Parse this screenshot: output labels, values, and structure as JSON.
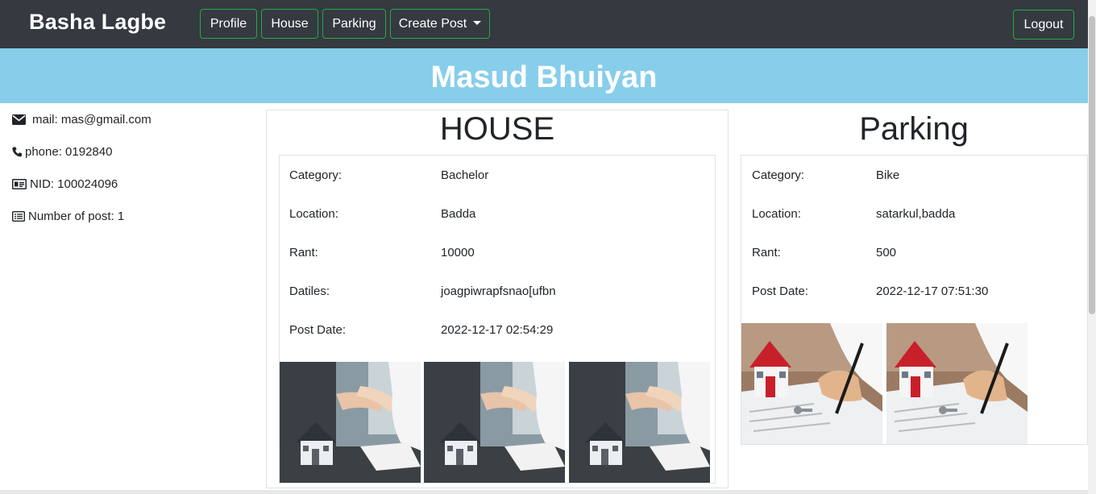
{
  "navbar": {
    "brand": "Basha Lagbe",
    "profile_label": "Profile",
    "house_label": "House",
    "parking_label": "Parking",
    "create_post_label": "Create Post",
    "logout_label": "Logout",
    "accent_color": "#28a745",
    "background": "#343a40"
  },
  "banner": {
    "name": "Masud Bhuiyan",
    "background": "#87ceeb"
  },
  "user_info": {
    "mail": "mail: mas@gmail.com",
    "phone": "phone: 0192840",
    "nid": "NID: 100024096",
    "posts": "Number of post: 1"
  },
  "house": {
    "title": "HOUSE",
    "fields": [
      {
        "label": "Category:",
        "value": "Bachelor"
      },
      {
        "label": "Location:",
        "value": "Badda"
      },
      {
        "label": "Rant:",
        "value": "10000"
      },
      {
        "label": "Datiles:",
        "value": "joagpiwrapfsnao[ufbn"
      },
      {
        "label": "Post Date:",
        "value": "2022-12-17 02:54:29"
      }
    ],
    "photo_icon": "handshake-house-photo"
  },
  "parking": {
    "title": "Parking",
    "fields": [
      {
        "label": "Category:",
        "value": "Bike"
      },
      {
        "label": "Location:",
        "value": "satarkul,badda"
      },
      {
        "label": "Rant:",
        "value": "500"
      },
      {
        "label": "Post Date:",
        "value": "2022-12-17 07:51:30"
      }
    ],
    "photo_icon": "signing-house-photo"
  }
}
